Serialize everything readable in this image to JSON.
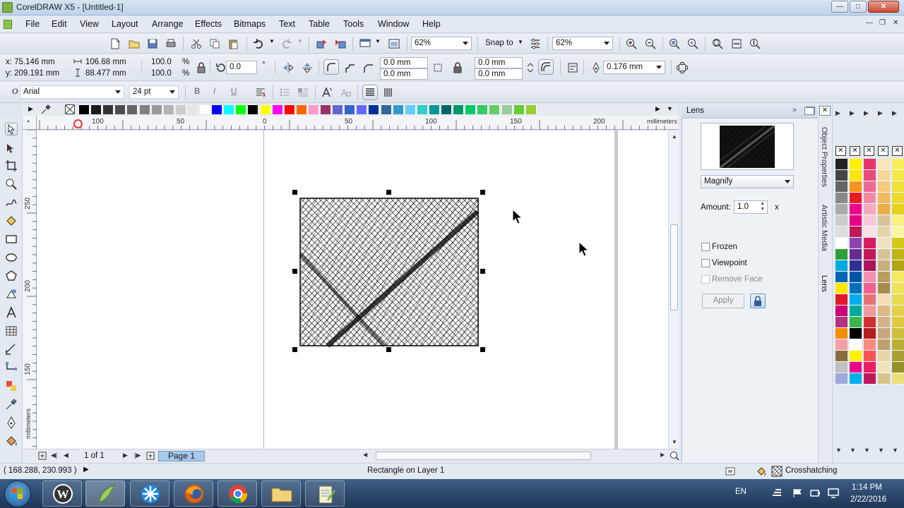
{
  "window": {
    "title": "CorelDRAW X5 - [Untitled-1]"
  },
  "menu": [
    "File",
    "Edit",
    "View",
    "Layout",
    "Arrange",
    "Effects",
    "Bitmaps",
    "Text",
    "Table",
    "Tools",
    "Window",
    "Help"
  ],
  "standard_toolbar": {
    "zoom1": "62%",
    "snap_to": "Snap to",
    "zoom2": "62%"
  },
  "property_bar": {
    "x": "x: 75.146 mm",
    "y": "y: 209.191 mm",
    "width": "106.68 mm",
    "height": "88.477 mm",
    "scale_x": "100.0",
    "scale_y": "100.0",
    "percent": "%",
    "rotation": "0.0",
    "degree": "°",
    "corner1": "0.0 mm",
    "corner2": "0.0 mm",
    "corner3": "0.0 mm",
    "corner4": "0.0 mm",
    "outline_width": "0.176 mm"
  },
  "text_bar": {
    "font": "Arial",
    "size": "24 pt"
  },
  "rulers": {
    "h_labels": [
      "100",
      "50",
      "0",
      "50",
      "100",
      "150",
      "200"
    ],
    "v_labels": [
      "250",
      "200",
      "150"
    ],
    "unit_h": "millimeters",
    "unit_v": "millimeters"
  },
  "page_nav": {
    "count": "1 of 1",
    "tab": "Page 1"
  },
  "docker": {
    "title": "Lens",
    "lens_type": "Magnify",
    "amount_label": "Amount:",
    "amount_value": "1.0",
    "amount_unit": "x",
    "frozen": "Frozen",
    "viewpoint": "Viewpoint",
    "remove_face": "Remove Face",
    "apply": "Apply"
  },
  "side_tabs": [
    "Object Properties",
    "Artistic Media",
    "Lens"
  ],
  "status": {
    "coords": "( 168.288, 230.993 )",
    "selection": "Rectangle on Layer 1",
    "fill": "Crosshatching"
  },
  "taskbar": {
    "lang": "EN",
    "time": "1:14 PM",
    "date": "2/22/2016"
  },
  "colors": {
    "palette_top": [
      "#000000",
      "#1a1a1a",
      "#333333",
      "#4d4d4d",
      "#666666",
      "#808080",
      "#999999",
      "#b3b3b3",
      "#cccccc",
      "#e6e6e6",
      "#ffffff",
      "#0000ff",
      "#00ffff",
      "#00ff00",
      "#000000",
      "#ffff00",
      "#ff00ff",
      "#ff0000",
      "#ff6600",
      "#ff99cc",
      "#993366",
      "#6666cc",
      "#3366cc",
      "#6666ff",
      "#003399",
      "#336699",
      "#3399cc",
      "#66ccff",
      "#33cccc",
      "#009999",
      "#006666",
      "#009966",
      "#00cc66",
      "#33cc66",
      "#66cc66",
      "#99cc99",
      "#66cc33",
      "#99cc33"
    ],
    "right_col1": [
      "#222222",
      "#444444",
      "#666666",
      "#888888",
      "#aaaaaa",
      "#cccccc",
      "#dddddd",
      "#ffffff",
      "#2e9e3a",
      "#00aae0",
      "#0066b3",
      "#ffe600",
      "#e5172b",
      "#cc0077",
      "#b4327f",
      "#f28c00",
      "#f5a0a6",
      "#8a6d3b",
      "#c0c0c0",
      "#9fa8da"
    ],
    "right_col2": [
      "#fff200",
      "#ffe600",
      "#f7941d",
      "#ed1c24",
      "#ec008c",
      "#e6007e",
      "#c2185b",
      "#8e44ad",
      "#662d91",
      "#2e3192",
      "#0054a6",
      "#0072bc",
      "#00aeef",
      "#00a99d",
      "#39b54a",
      "#000000",
      "#ffffff",
      "#fff200",
      "#ec008c",
      "#00aeef"
    ],
    "right_col3": [
      "#e8336c",
      "#e84a7a",
      "#ec6a91",
      "#f08aa8",
      "#f4a9bf",
      "#f8c7d5",
      "#fbe0e8",
      "#d81b60",
      "#c2185b",
      "#ad1457",
      "#f48fb1",
      "#f06292",
      "#e57373",
      "#ef9a9a",
      "#d32f2f",
      "#b71c1c",
      "#ff8a80",
      "#ff5252",
      "#e91e63",
      "#c2185b"
    ],
    "right_col4": [
      "#f9e4b7",
      "#f6d79a",
      "#f3c97d",
      "#efbb60",
      "#ecad43",
      "#d9c49a",
      "#e6d3a8",
      "#f0e0c0",
      "#d8c39b",
      "#c9b07e",
      "#bb9d61",
      "#a88a4e",
      "#f5deb3",
      "#deb887",
      "#d2b48c",
      "#c8a87a",
      "#bfa06a",
      "#e8d5a5",
      "#f2e2b8",
      "#d9c28c"
    ],
    "right_col5": [
      "#f7ef5a",
      "#f4e84a",
      "#efe03a",
      "#ebd92b",
      "#e6d11c",
      "#f9f27e",
      "#fbf6a2",
      "#d4c81a",
      "#c2b617",
      "#b0a515",
      "#f2ea63",
      "#ede25a",
      "#e8da51",
      "#e3d248",
      "#dfca3f",
      "#ccc03a",
      "#bab035",
      "#a8a030",
      "#969029",
      "#e9e07a"
    ]
  }
}
